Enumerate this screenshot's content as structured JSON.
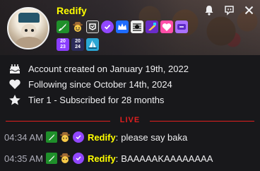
{
  "header": {
    "username": "Redify",
    "badges_row1": [
      "sword-badge-icon",
      "cowboy-badge-icon",
      "prime-badge-icon",
      "verified-badge-icon",
      "crown-badge-icon",
      "lines-badge-icon",
      "quill-badge-icon",
      "heart-badge-icon",
      "purple-badge-icon"
    ],
    "badges_row2": [
      {
        "name": "badge-2023",
        "text_top": "20",
        "text_bottom": "23"
      },
      {
        "name": "badge-2024",
        "text_top": "20",
        "text_bottom": "24"
      },
      {
        "name": "sail-badge-icon"
      }
    ],
    "controls": [
      "bell-icon",
      "whisper-icon",
      "close-icon"
    ]
  },
  "info": {
    "created": "Account created on January 19th, 2022",
    "following": "Following since October 14th, 2024",
    "subscription": "Tier 1 - Subscribed for 28 months"
  },
  "divider": {
    "label": "LIVE",
    "color": "#e01f1f"
  },
  "messages": [
    {
      "time": "04:34 AM",
      "name": "Redify",
      "text": "please say baka"
    },
    {
      "time": "04:35 AM",
      "name": "Redify",
      "text": "BAAAAAKAAAAAAAA"
    }
  ],
  "colors": {
    "username": "#ffff00",
    "background": "#18181b",
    "accent": "#9147ff"
  }
}
